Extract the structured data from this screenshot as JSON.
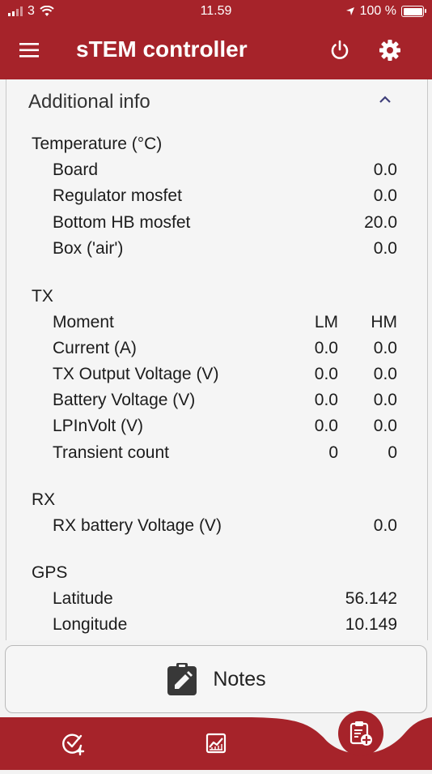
{
  "status_bar": {
    "carrier": "3",
    "time": "11.59",
    "battery": "100 %"
  },
  "appbar": {
    "title": "sTEM controller"
  },
  "panel": {
    "header": "Additional info"
  },
  "temperature": {
    "title": "Temperature (°C)",
    "rows": [
      {
        "label": "Board",
        "value": "0.0"
      },
      {
        "label": "Regulator mosfet",
        "value": "0.0"
      },
      {
        "label": "Bottom HB mosfet",
        "value": "20.0"
      },
      {
        "label": "Box ('air')",
        "value": "0.0"
      }
    ]
  },
  "tx": {
    "title": "TX",
    "header": {
      "label": "Moment",
      "lm": "LM",
      "hm": "HM"
    },
    "rows": [
      {
        "label": "Current (A)",
        "lm": "0.0",
        "hm": "0.0"
      },
      {
        "label": "TX Output Voltage (V)",
        "lm": "0.0",
        "hm": "0.0"
      },
      {
        "label": "Battery Voltage (V)",
        "lm": "0.0",
        "hm": "0.0"
      },
      {
        "label": "LPInVolt (V)",
        "lm": "0.0",
        "hm": "0.0"
      },
      {
        "label": "Transient count",
        "lm": "0",
        "hm": "0"
      }
    ]
  },
  "rx": {
    "title": "RX",
    "rows": [
      {
        "label": "RX battery Voltage (V)",
        "value": "0.0"
      }
    ]
  },
  "gps": {
    "title": "GPS",
    "rows": [
      {
        "label": "Latitude",
        "value": "56.142"
      },
      {
        "label": "Longitude",
        "value": "10.149"
      }
    ]
  },
  "notes_button": {
    "label": "Notes",
    "icon": "clipboard-edit-icon"
  },
  "bottom_nav": {
    "items": [
      {
        "icon": "check-add-icon"
      },
      {
        "icon": "chart-icon"
      },
      {
        "icon": "clipboard-add-icon",
        "active": true
      }
    ]
  },
  "colors": {
    "primary": "#a6232a",
    "background": "#f3f3f3"
  }
}
